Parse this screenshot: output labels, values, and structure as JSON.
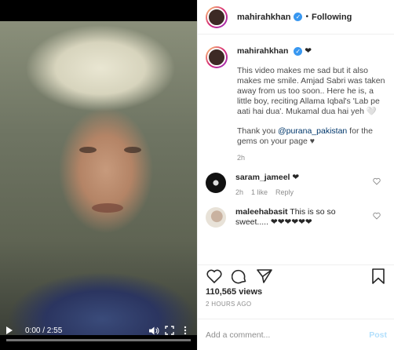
{
  "video": {
    "time": "0:00 / 2:55",
    "progress": 0
  },
  "header": {
    "username": "mahirahkhan",
    "separator": "•",
    "follow": "Following"
  },
  "caption": {
    "username": "mahirahkhan",
    "suffix": "❤",
    "para1": "This video makes me sad but it also makes me smile. Amjad Sabri was taken away from us too soon.. Here he is, a little boy, reciting Allama Iqbal's 'Lab pe aati hai dua'. Mukamal dua hai yeh 🤍",
    "para2_pre": "Thank you ",
    "mention": "@purana_pakistan",
    "para2_post": " for the gems on your page ♥",
    "time": "2h"
  },
  "comments": [
    {
      "username": "saram_jameel",
      "text": "❤",
      "time": "2h",
      "likes": "1 like",
      "reply": "Reply"
    },
    {
      "username": "maleehabasit",
      "text": "This is so so sweet..... ❤❤❤❤❤❤",
      "time": "",
      "likes": "",
      "reply": ""
    }
  ],
  "stats": {
    "views": "110,565 views",
    "ago": "2 HOURS AGO"
  },
  "add_comment": {
    "placeholder": "Add a comment...",
    "post": "Post"
  },
  "colors": {
    "verified": "#3897f0",
    "post_disabled": "#b2dffc",
    "mention": "#00376b"
  }
}
